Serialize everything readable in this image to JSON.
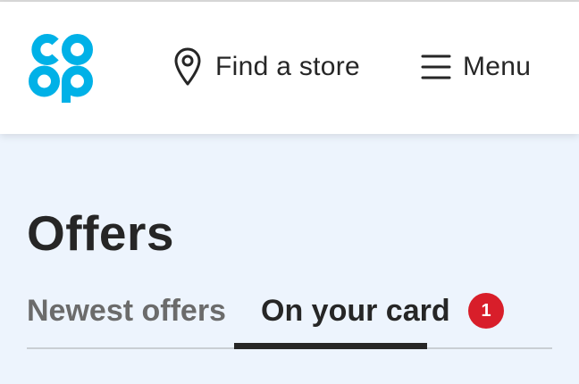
{
  "header": {
    "logo_text": "co op",
    "find_store_label": "Find a store",
    "menu_label": "Menu"
  },
  "colors": {
    "brand_blue": "#00b1e7",
    "badge_red": "#d81e2a",
    "text_dark": "#262626",
    "page_bg": "#edf4fd"
  },
  "main": {
    "title": "Offers",
    "tabs": [
      {
        "label": "Newest offers",
        "selected": false
      },
      {
        "label": "On your card",
        "selected": true,
        "badge": "1"
      }
    ]
  }
}
